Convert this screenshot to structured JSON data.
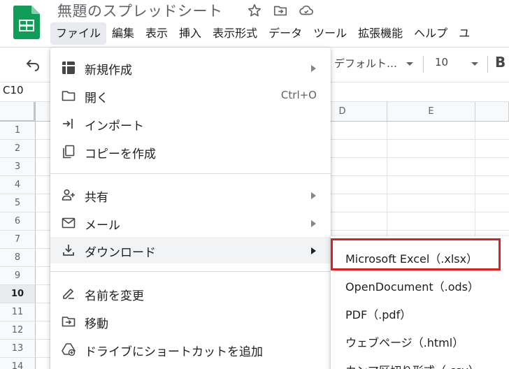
{
  "document": {
    "title": "無題のスプレッドシート"
  },
  "menubar": {
    "items": [
      "ファイル",
      "編集",
      "表示",
      "挿入",
      "表示形式",
      "データ",
      "ツール",
      "拡張機能",
      "ヘルプ",
      "ユ"
    ]
  },
  "toolbar": {
    "font": "デフォルト…",
    "font_size": "10",
    "bold": "B"
  },
  "namebox": {
    "cell": "C10"
  },
  "grid": {
    "columns": [
      "D",
      "E"
    ],
    "rows": [
      "1",
      "2",
      "3",
      "4",
      "5",
      "6",
      "7",
      "8",
      "9",
      "10",
      "11",
      "12",
      "13",
      "14"
    ],
    "selected_row": "10"
  },
  "file_menu": {
    "items": [
      {
        "label": "新規作成",
        "icon": "new-icon",
        "submenu": true
      },
      {
        "label": "開く",
        "icon": "folder-icon",
        "shortcut": "Ctrl+O"
      },
      {
        "label": "インポート",
        "icon": "import-icon"
      },
      {
        "label": "コピーを作成",
        "icon": "copy-icon"
      },
      {
        "label": "共有",
        "icon": "share-icon",
        "submenu": true
      },
      {
        "label": "メール",
        "icon": "mail-icon",
        "submenu": true
      },
      {
        "label": "ダウンロード",
        "icon": "download-icon",
        "submenu": true,
        "highlighted": true
      },
      {
        "label": "名前を変更",
        "icon": "rename-icon"
      },
      {
        "label": "移動",
        "icon": "move-icon"
      },
      {
        "label": "ドライブにショートカットを追加",
        "icon": "drive-shortcut-icon"
      }
    ]
  },
  "download_menu": {
    "items": [
      {
        "label": "Microsoft Excel（.xlsx）",
        "highlighted": true
      },
      {
        "label": "OpenDocument（.ods）"
      },
      {
        "label": "PDF（.pdf）"
      },
      {
        "label": "ウェブページ（.html）"
      },
      {
        "label": "カンマ区切り形式（.csv）"
      }
    ]
  },
  "colors": {
    "sheets_green": "#0f9d58",
    "highlight_red": "#e01e1e",
    "menu_hover": "#f1f3f4"
  }
}
